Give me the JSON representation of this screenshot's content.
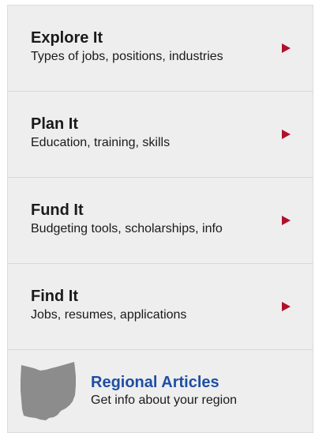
{
  "menu": {
    "items": [
      {
        "title": "Explore It",
        "subtitle": "Types of jobs, positions, industries"
      },
      {
        "title": "Plan It",
        "subtitle": "Education, training, skills"
      },
      {
        "title": "Fund It",
        "subtitle": "Budgeting tools, scholarships, info"
      },
      {
        "title": "Find It",
        "subtitle": "Jobs, resumes, applications"
      }
    ]
  },
  "regional": {
    "title": "Regional Articles",
    "subtitle": "Get info about your region",
    "icon": "ohio-state-icon"
  },
  "colors": {
    "arrow": "#b0102a",
    "link": "#1f4ea3",
    "background": "#eeeeee"
  }
}
